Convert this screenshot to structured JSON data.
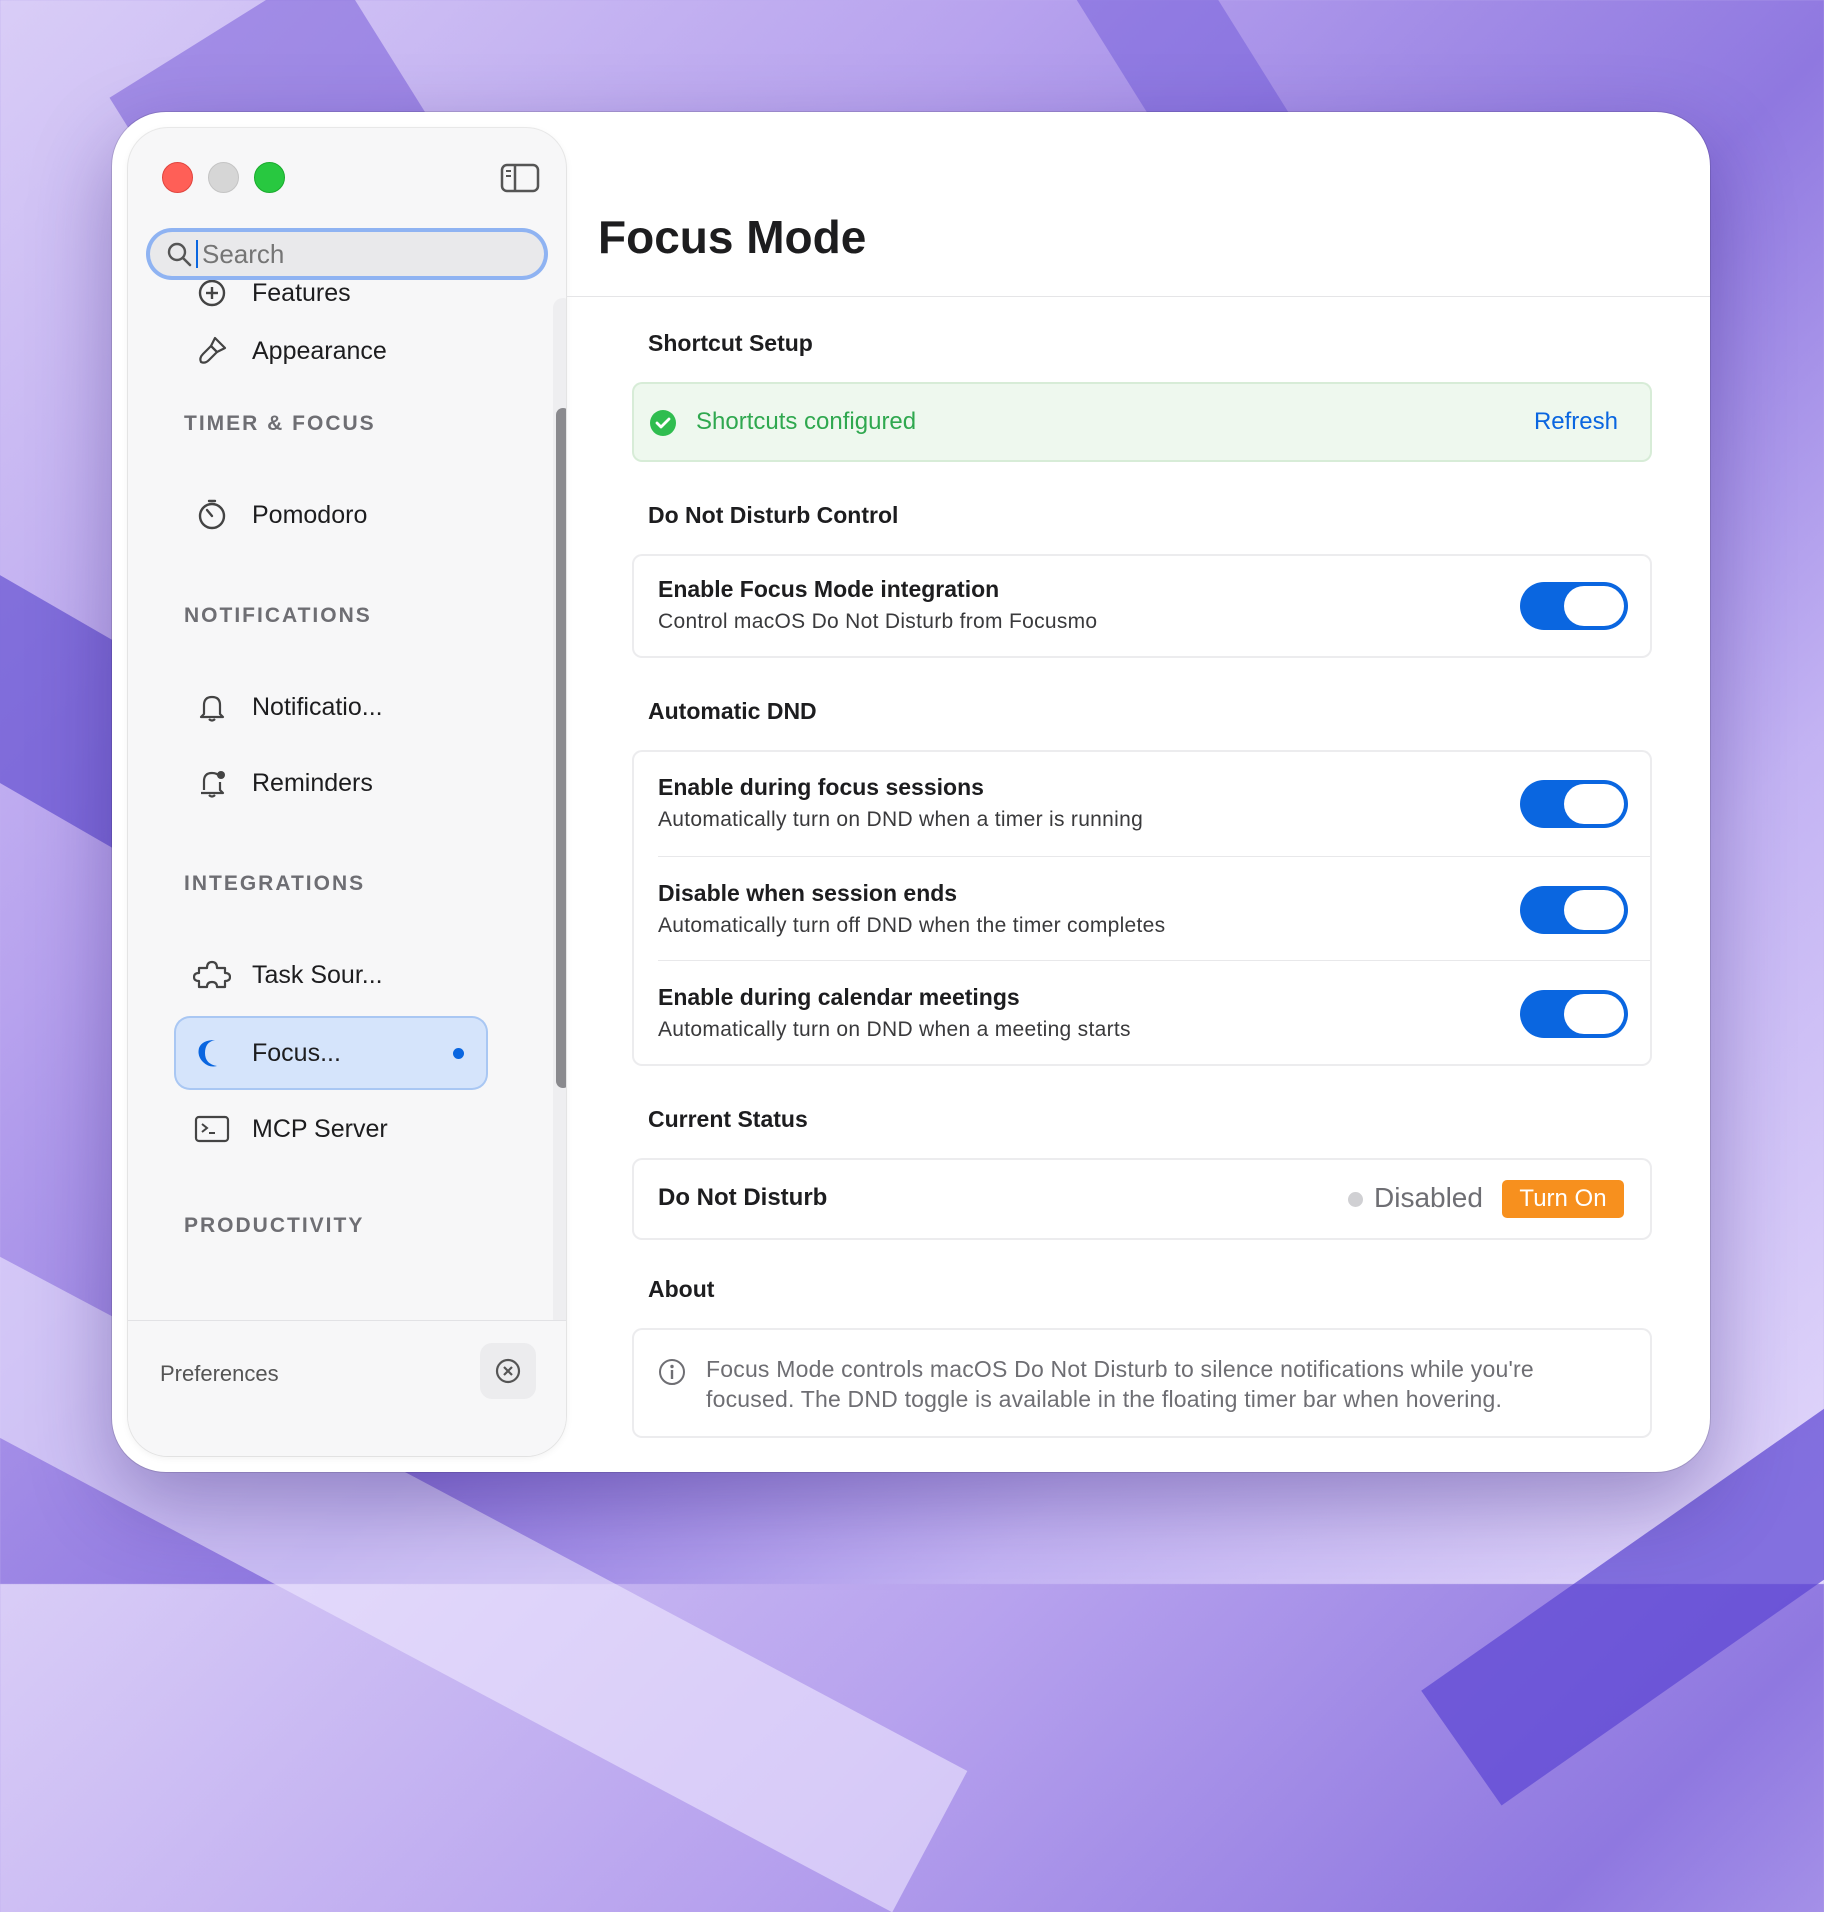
{
  "sidebar": {
    "search": {
      "placeholder": "Search"
    },
    "items": [
      {
        "label": "Features",
        "icon": "plus-circle-icon"
      },
      {
        "label": "Appearance",
        "icon": "paintbrush-icon"
      },
      {
        "label": "Pomodoro",
        "icon": "timer-icon"
      },
      {
        "label": "Notificatio...",
        "icon": "bell-icon"
      },
      {
        "label": "Reminders",
        "icon": "bell-badge-icon"
      },
      {
        "label": "Task Sour...",
        "icon": "puzzle-icon"
      },
      {
        "label": "Focus...",
        "icon": "moon-icon",
        "active": true
      },
      {
        "label": "MCP Server",
        "icon": "terminal-icon"
      }
    ],
    "sections": [
      "TIMER & FOCUS",
      "NOTIFICATIONS",
      "INTEGRATIONS",
      "PRODUCTIVITY"
    ],
    "footer": {
      "label": "Preferences",
      "icon": "close-circle-icon"
    }
  },
  "main": {
    "title": "Focus Mode",
    "shortcut": {
      "heading": "Shortcut Setup",
      "status": "Shortcuts configured",
      "action": "Refresh"
    },
    "dnd_control": {
      "heading": "Do Not Disturb Control",
      "rows": [
        {
          "title": "Enable Focus Mode integration",
          "subtitle": "Control macOS Do Not Disturb from Focusmo",
          "on": true
        }
      ]
    },
    "auto_dnd": {
      "heading": "Automatic DND",
      "rows": [
        {
          "title": "Enable during focus sessions",
          "subtitle": "Automatically turn on DND when a timer is running",
          "on": true
        },
        {
          "title": "Disable when session ends",
          "subtitle": "Automatically turn off DND when the timer completes",
          "on": true
        },
        {
          "title": "Enable during calendar meetings",
          "subtitle": "Automatically turn on DND when a meeting starts",
          "on": true
        }
      ]
    },
    "current_status": {
      "heading": "Current Status",
      "label": "Do Not Disturb",
      "state": "Disabled",
      "action": "Turn On"
    },
    "about": {
      "heading": "About",
      "text": "Focus Mode controls macOS Do Not Disturb to silence notifications while you're focused. The DND toggle is available in the floating timer bar when hovering."
    }
  },
  "colors": {
    "accent": "#0a66e0",
    "success": "#2fa84f",
    "warning": "#f7901e"
  }
}
